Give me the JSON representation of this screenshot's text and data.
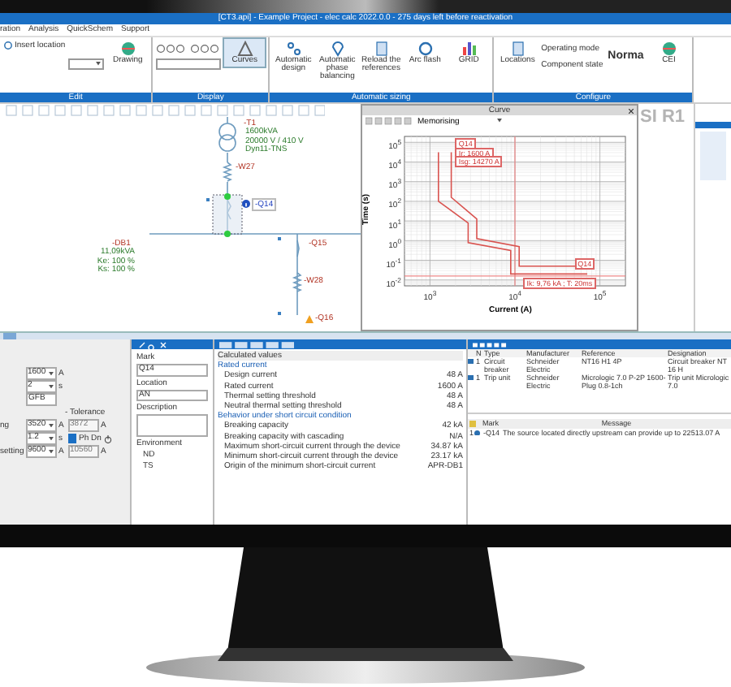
{
  "window": {
    "title": "[CT3.api] - Example Project - elec calc 2022.0.0 - 275 days left before reactivation"
  },
  "menu": [
    "ration",
    "Analysis",
    "QuickSchem",
    "Support"
  ],
  "ribbon": {
    "groups": [
      {
        "label": "Edit",
        "items": [
          {
            "kind": "small",
            "label": "Insert location",
            "selected": false
          },
          {
            "kind": "field"
          },
          {
            "kind": "large",
            "label": "Drawing",
            "selected": false
          }
        ]
      },
      {
        "label": "Display",
        "items": [
          {
            "kind": "zoom"
          },
          {
            "kind": "large",
            "label": "Curves",
            "selected": true
          }
        ]
      },
      {
        "label": "Automatic sizing",
        "items": [
          {
            "kind": "large",
            "label": "Automatic design",
            "selected": false
          },
          {
            "kind": "large",
            "label": "Automatic phase balancing",
            "selected": false
          },
          {
            "kind": "large",
            "label": "Reload the references",
            "selected": false
          },
          {
            "kind": "large",
            "label": "Arc flash",
            "selected": false
          },
          {
            "kind": "large",
            "label": "GRID",
            "selected": false
          }
        ]
      },
      {
        "label": "Configure",
        "items": [
          {
            "kind": "large",
            "label": "Locations",
            "selected": false
          },
          {
            "kind": "stack",
            "labels": [
              "Operating mode",
              "Component state"
            ]
          },
          {
            "kind": "big-text",
            "label": "Norma"
          },
          {
            "kind": "large",
            "label": "CEI",
            "selected": false
          }
        ]
      }
    ]
  },
  "schematic": {
    "sheet_label": "SI R1",
    "transformer": {
      "mark": "-T1",
      "lines": [
        "1600kVA",
        "20000 V / 410 V",
        "Dyn11-TNS"
      ]
    },
    "cable_upper": {
      "mark": "-W27"
    },
    "breaker": {
      "mark": "-Q14",
      "selected": true
    },
    "board": {
      "mark": "-DB1",
      "lines": [
        "11,09kVA",
        "Ke: 100 %",
        "Ks: 100 %"
      ]
    },
    "feeder_breaker": {
      "mark": "-Q15"
    },
    "feeder_cable": {
      "mark": "-W28"
    },
    "lower_device": {
      "mark": "-Q16"
    }
  },
  "curve_window": {
    "title": "Curve",
    "dropdown": "Memorising",
    "plot": {
      "xlabel": "Current (A)",
      "ylabel": "Time (s)",
      "xtick_labels": [
        "10$^{3}$",
        "10$^{4}$",
        "10$^{5}$"
      ],
      "ytick_labels": [
        "10$^{5}$",
        "10$^{4}$",
        "10$^{3}$",
        "10$^{2}$",
        "10$^{1}$",
        "10$^{0}$",
        "10$^{-1}$",
        "10$^{-2}$"
      ],
      "curve_labels": [
        "Q14",
        "Ir: 1600 A",
        "Isg: 14270 A",
        "Q14",
        "Ik: 9,76 kA ; T: 20ms"
      ]
    }
  },
  "settings": [
    {
      "kind": "select",
      "value": "1600",
      "unit": "A"
    },
    {
      "kind": "select",
      "value": "2",
      "unit": "s"
    },
    {
      "kind": "field",
      "value": "GFB"
    },
    {
      "kind": "heading",
      "label": "- Tolerance"
    },
    {
      "kind": "select",
      "label": "ng",
      "value": "3520",
      "unit": "A",
      "tolerance": "3872",
      "tolerance_unit": "A"
    },
    {
      "kind": "check",
      "value": "1.2",
      "unit": "s",
      "check_label": "Ph Dn",
      "checked": true
    },
    {
      "kind": "select",
      "label": "setting",
      "value": "9600",
      "unit": "A",
      "tolerance": "10560",
      "tolerance_unit": "A"
    }
  ],
  "properties": {
    "fields": [
      {
        "label": "Mark",
        "value": "Q14",
        "multiline": false
      },
      {
        "label": "Location",
        "value": "AN",
        "multiline": false
      },
      {
        "label": "Description",
        "multiline": true
      }
    ],
    "environment": {
      "label": "Environment",
      "items": [
        "ND",
        "TS"
      ]
    }
  },
  "calculated": {
    "title": "Calculated values",
    "sections": [
      {
        "label": "Rated current",
        "rows": [
          {
            "label": "Design current",
            "value": "48 A"
          },
          {
            "label": "Rated current",
            "value": "1600 A"
          },
          {
            "label": "Thermal setting threshold",
            "value": "48 A"
          },
          {
            "label": "Neutral thermal setting threshold",
            "value": "48 A"
          }
        ]
      },
      {
        "label": "Behavior under short circuit condition",
        "rows": [
          {
            "label": "Breaking capacity",
            "value": "42 kA"
          },
          {
            "label": "Breaking capacity with cascading",
            "value": "N/A"
          },
          {
            "label": "Maximum short-circuit current through the device",
            "value": "34.87 kA"
          },
          {
            "label": "Minimum short-circuit current through the device",
            "value": "23.17 kA"
          },
          {
            "label": "Origin of the minimum short-circuit current",
            "value": "APR-DB1"
          }
        ]
      }
    ]
  },
  "components": {
    "columns": [
      "N",
      "Type",
      "Manufacturer",
      "Reference",
      "Designation"
    ],
    "rows": [
      [
        "1",
        "Circuit breaker",
        "Schneider Electric",
        "NT16 H1 4P",
        "Circuit breaker NT 16 H"
      ],
      [
        "1",
        "Trip unit",
        "Schneider Electric",
        "Micrologic 7.0 P-2P 1600-Plug 0.8-1ch",
        "Trip unit Micrologic 7.0"
      ]
    ]
  },
  "messages": {
    "columns": [
      "Mark",
      "Message"
    ],
    "rows": [
      {
        "index": "1",
        "mark": "-Q14",
        "text": "The source located directly upstream can provide up to 22513.07 A"
      }
    ]
  }
}
